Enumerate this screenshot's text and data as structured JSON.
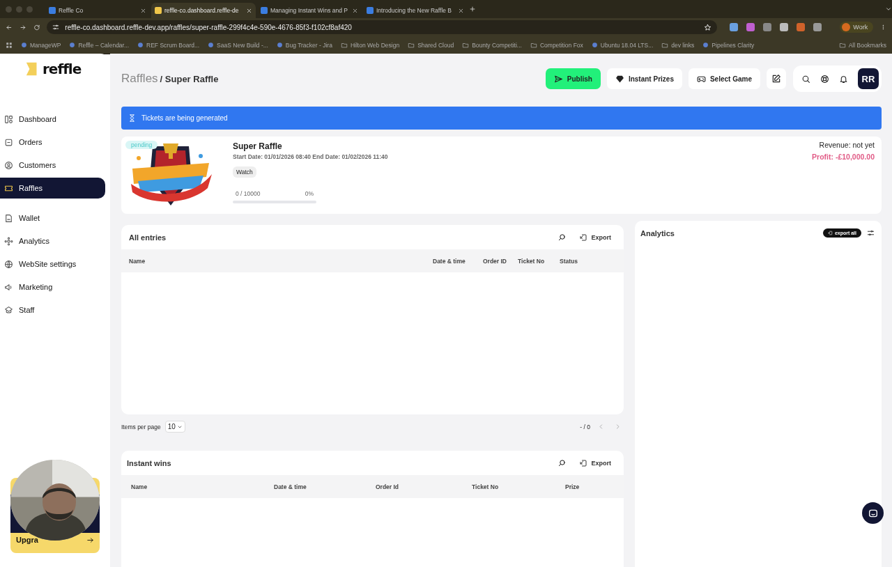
{
  "browser": {
    "tabs": [
      {
        "title": "Reffle Co",
        "selected": false
      },
      {
        "title": "reffle-co.dashboard.reffle-de",
        "selected": true
      },
      {
        "title": "Managing Instant Wins and P",
        "selected": false
      },
      {
        "title": "Introducing the New Raffle B",
        "selected": false
      }
    ],
    "url": "reffle-co.dashboard.reffle-dev.app/raffles/super-raffle-299f4c4e-590e-4676-85f3-f102cf8af420",
    "profile": "Work",
    "bookmarks": [
      {
        "label": "ManageWP",
        "kind": "site"
      },
      {
        "label": "Reffle – Calendar...",
        "kind": "site"
      },
      {
        "label": "REF Scrum Board...",
        "kind": "site"
      },
      {
        "label": "SaaS New Build -...",
        "kind": "site"
      },
      {
        "label": "Bug Tracker - Jira",
        "kind": "site"
      },
      {
        "label": "Hilton Web Design",
        "kind": "folder"
      },
      {
        "label": "Shared Cloud",
        "kind": "folder"
      },
      {
        "label": "Bounty Competiti...",
        "kind": "folder"
      },
      {
        "label": "Competition Fox",
        "kind": "folder"
      },
      {
        "label": "Ubuntu 18.04 LTS...",
        "kind": "site"
      },
      {
        "label": "dev links",
        "kind": "folder"
      },
      {
        "label": "Pipelines Clarity",
        "kind": "site"
      }
    ],
    "all_bookmarks": "All Bookmarks"
  },
  "sidebar": {
    "logo": "reffle",
    "items": [
      {
        "label": "Dashboard",
        "selected": false
      },
      {
        "label": "Orders",
        "selected": false
      },
      {
        "label": "Customers",
        "selected": false
      },
      {
        "label": "Raffles",
        "selected": true
      },
      {
        "label": "Wallet",
        "selected": false
      },
      {
        "label": "Analytics",
        "selected": false
      },
      {
        "label": "WebSite settings",
        "selected": false
      },
      {
        "label": "Marketing",
        "selected": false
      },
      {
        "label": "Staff",
        "selected": false
      }
    ],
    "upgrade": "Upgra"
  },
  "header": {
    "breadcrumb_parent": "Raffles",
    "breadcrumb_current": "/ Super Raffle",
    "buttons": [
      {
        "label": "Publish",
        "kind": "primary"
      },
      {
        "label": "Instant Prizes",
        "kind": "diamond"
      },
      {
        "label": "Select Game",
        "kind": "gamepad"
      }
    ],
    "avatar": "RR"
  },
  "banner": {
    "text": "Tickets are being generated"
  },
  "raffle": {
    "status": "pending",
    "title": "Super Raffle",
    "dates": "Start Date: 01/01/2026 08:40 End Date: 01/02/2026 11:40",
    "tag": "Watch",
    "sold": "0 / 10000",
    "percent": "0%",
    "level": 0,
    "revenue": "Revenue: not yet",
    "profit": "Profit: -£10,000.00"
  },
  "entries": {
    "title": "All entries",
    "export": "Export",
    "columns": [
      "Name",
      "Date & time",
      "Order ID",
      "Ticket No",
      "Status"
    ],
    "items_per_page_label": "Items per page",
    "items_per_page": "10",
    "range": "- / 0"
  },
  "analytics": {
    "title": "Analytics",
    "export_all": "export all"
  },
  "instant_wins": {
    "title": "Instant wins",
    "export": "Export",
    "columns": [
      "Name",
      "Date & time",
      "Order Id",
      "Ticket No",
      "Prize"
    ]
  }
}
